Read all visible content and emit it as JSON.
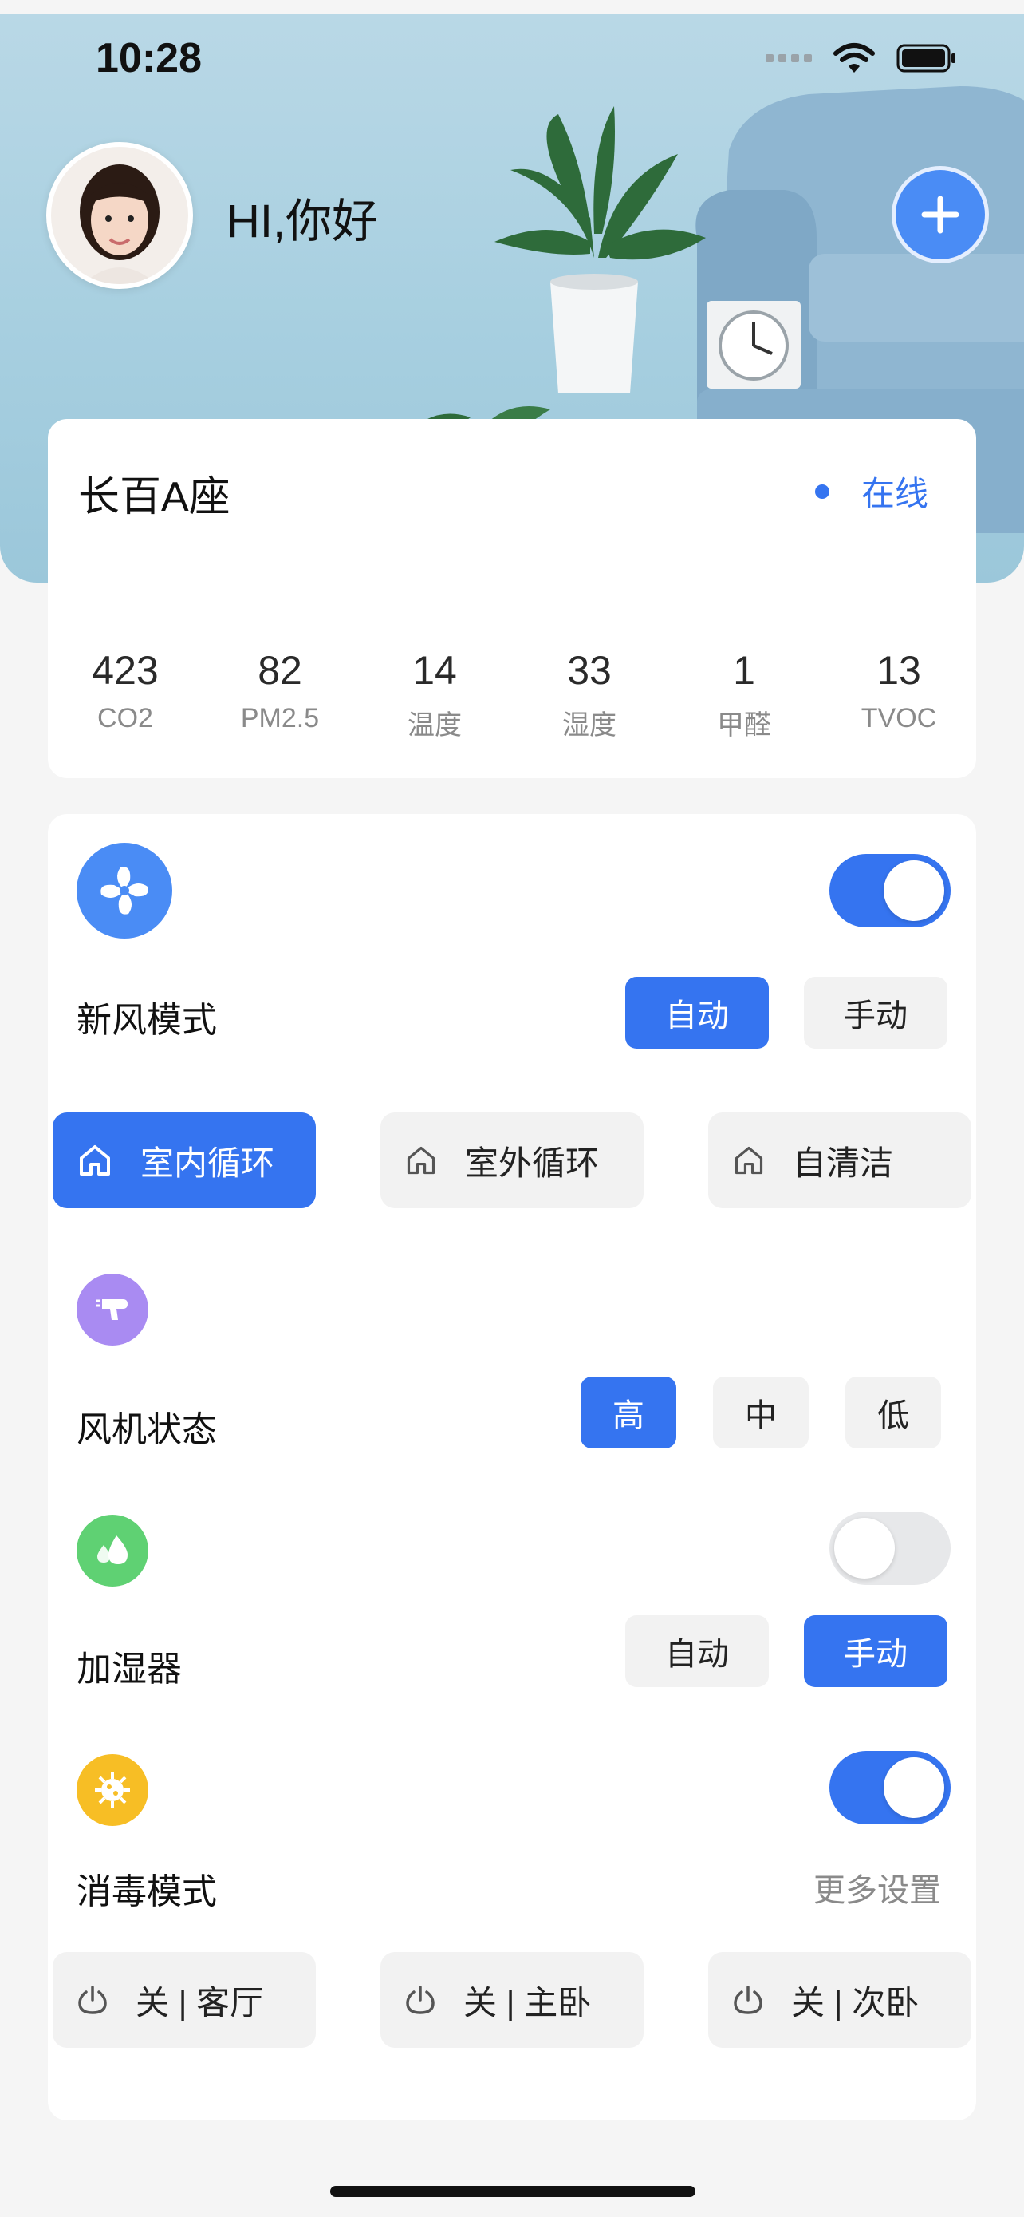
{
  "status_bar": {
    "time": "10:28"
  },
  "header": {
    "greeting": "HI,你好"
  },
  "location": {
    "name": "长百A座",
    "status": "在线",
    "status_color": "#3574F0"
  },
  "metrics": [
    {
      "value": "423",
      "label": "CO2"
    },
    {
      "value": "82",
      "label": "PM2.5"
    },
    {
      "value": "14",
      "label": "温度"
    },
    {
      "value": "33",
      "label": "湿度"
    },
    {
      "value": "1",
      "label": "甲醛"
    },
    {
      "value": "13",
      "label": "TVOC"
    }
  ],
  "fresh_air": {
    "title": "新风模式",
    "enabled": true,
    "modes": [
      "自动",
      "手动"
    ],
    "active_mode": "自动",
    "circulation": [
      "室内循环",
      "室外循环",
      "自清洁"
    ],
    "active_circulation": "室内循环"
  },
  "fan": {
    "title": "风机状态",
    "speeds": [
      "高",
      "中",
      "低"
    ],
    "active_speed": "高"
  },
  "humidifier": {
    "title": "加湿器",
    "enabled": false,
    "modes": [
      "自动",
      "手动"
    ],
    "active_mode": "手动"
  },
  "disinfect": {
    "title": "消毒模式",
    "enabled": true,
    "more_label": "更多设置",
    "rooms": [
      "关 | 客厅",
      "关 | 主卧",
      "关 | 次卧"
    ]
  },
  "colors": {
    "accent": "#3574F0",
    "fan_icon": "#A98BF2",
    "humid_icon": "#5FD173",
    "disinfect_icon": "#F7BE25",
    "freshair_icon": "#4A8CF5"
  }
}
